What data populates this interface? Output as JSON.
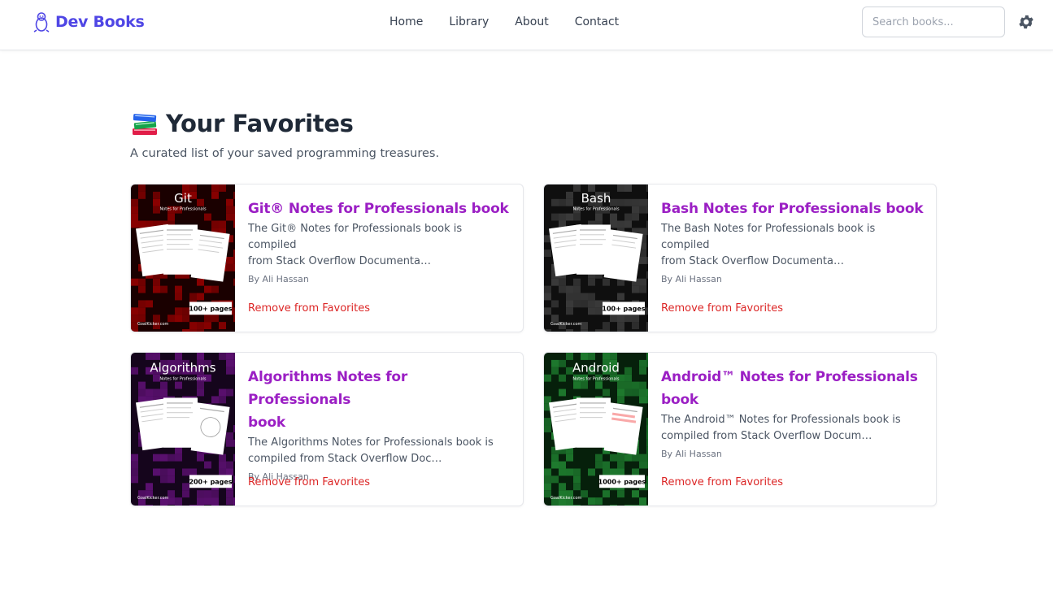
{
  "brand": {
    "name": "Dev Books",
    "color": "#4f46e5"
  },
  "nav": {
    "items": [
      {
        "label": "Home"
      },
      {
        "label": "Library"
      },
      {
        "label": "About"
      },
      {
        "label": "Contact"
      }
    ]
  },
  "search": {
    "placeholder": "Search books..."
  },
  "page": {
    "title": "Your Favorites",
    "subtitle": "A curated list of your saved programming treasures."
  },
  "books": [
    {
      "title": "Git® Notes for Professionals book",
      "description_line1": "The Git® Notes for Professionals book is compiled",
      "description_line2": "from Stack Overflow Documenta…",
      "author": "By Ali Hassan",
      "remove_label": "Remove from Favorites",
      "cover": {
        "name": "Git",
        "subtitle": "Notes for Professionals",
        "pages": "100+ pages",
        "footer": "GoalKicker.com",
        "color": "#8b0000"
      }
    },
    {
      "title": "Bash Notes for Professionals book",
      "description_line1": "The Bash Notes for Professionals book is compiled",
      "description_line2": "from Stack Overflow Documenta…",
      "author": "By Ali Hassan",
      "remove_label": "Remove from Favorites",
      "cover": {
        "name": "Bash",
        "subtitle": "Notes for Professionals",
        "pages": "100+ pages",
        "footer": "GoalKicker.com",
        "color": "#3a3a3a"
      }
    },
    {
      "title_line1": "Algorithms Notes for Professionals",
      "title_line2": "book",
      "description_line1": "The Algorithms Notes for Professionals book is",
      "description_line2": "compiled from Stack Overflow Doc…",
      "author": "By Ali Hassan",
      "remove_label": "Remove from Favorites",
      "cover": {
        "name": "Algorithms",
        "subtitle": "Notes for Professionals",
        "pages": "200+ pages",
        "footer": "GoalKicker.com",
        "color": "#5b1070"
      }
    },
    {
      "title_line1": "Android™ Notes for Professionals",
      "title_line2": "book",
      "description_line1": "The Android™ Notes for Professionals book is",
      "description_line2": "compiled from Stack Overflow Docum…",
      "author": "By Ali Hassan",
      "remove_label": "Remove from Favorites",
      "cover": {
        "name": "Android",
        "subtitle": "Notes for Professionals",
        "pages": "1000+ pages",
        "footer": "GoalKicker.com",
        "color": "#1e7a2e"
      }
    }
  ],
  "icons": {
    "brand": "penguin-icon",
    "settings": "gear-icon",
    "title": "books-icon"
  }
}
